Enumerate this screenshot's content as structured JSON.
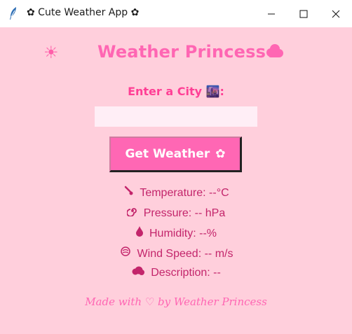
{
  "window": {
    "title": "✿ Cute Weather App ✿",
    "minimize": "—",
    "maximize": "☐",
    "close": "✕"
  },
  "header": {
    "sun": "☀",
    "title": "Weather Princess"
  },
  "form": {
    "label": "Enter a City 🌆:",
    "input_value": "",
    "button_label": "Get Weather",
    "button_icon": "✿"
  },
  "info": {
    "temperature": "Temperature: --°C",
    "pressure": "Pressure: -- hPa",
    "humidity": "Humidity: --%",
    "wind": "Wind Speed: -- m/s",
    "description": "Description: --"
  },
  "footer": {
    "text": "Made with ♡ by Weather Princess"
  },
  "colors": {
    "background": "#ffcfdc",
    "accent": "#ff66b3",
    "label_pink": "#ff3f95",
    "info_text": "#c3256b"
  }
}
